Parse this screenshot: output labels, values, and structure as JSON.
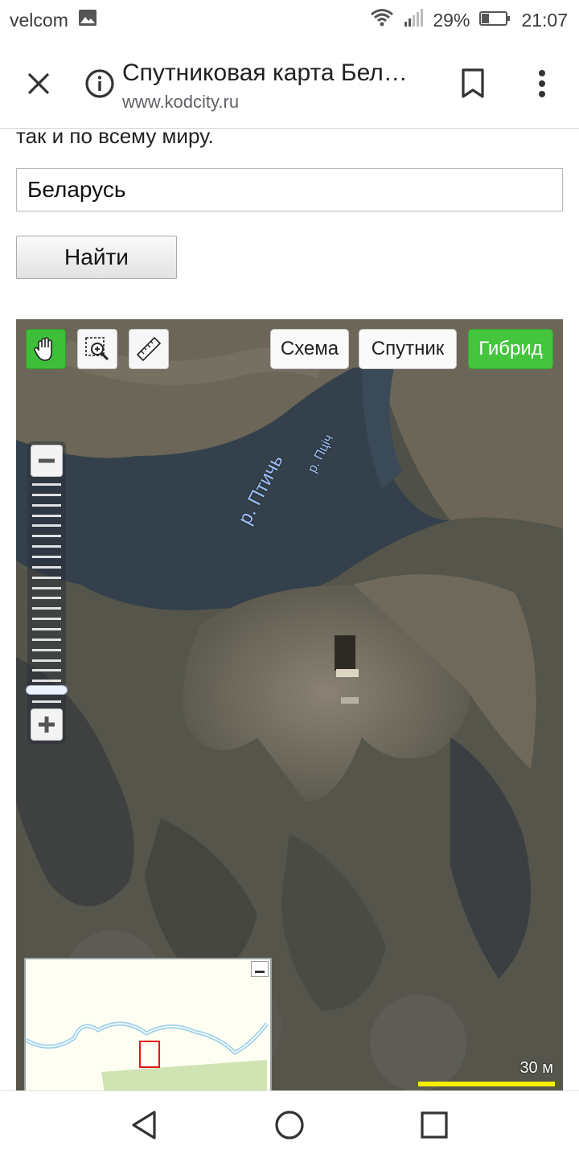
{
  "status_bar": {
    "carrier": "velcom",
    "battery": "29%",
    "time": "21:07",
    "icons": [
      "image-icon",
      "wifi-icon",
      "signal-icon",
      "battery-icon"
    ]
  },
  "browser": {
    "title": "Спутниковая карта Бел…",
    "url": "www.kodcity.ru",
    "icons": [
      "close-icon",
      "info-icon",
      "bookmark-icon",
      "more-vert-icon"
    ]
  },
  "page": {
    "cut_text": "так и по всему миру.",
    "search_value": "Беларусь",
    "search_button": "Найти"
  },
  "map": {
    "tools": [
      "hand-icon",
      "zoom-select-icon",
      "ruler-icon"
    ],
    "type_buttons": {
      "scheme": "Схема",
      "satellite": "Спутник",
      "hybrid": "Гибрид"
    },
    "active_type": "hybrid",
    "river_label_ru": "р. Птичь",
    "river_label_be": "р. Пціч",
    "zoom": {
      "level_fraction": 0.95
    },
    "scale_label": "30 м",
    "colors": {
      "active_green": "#45c43e",
      "scale_yellow": "#f5f000",
      "river_label": "#9dc0f5"
    }
  },
  "nav": {
    "icons": [
      "back-icon",
      "home-icon",
      "recents-icon"
    ]
  }
}
